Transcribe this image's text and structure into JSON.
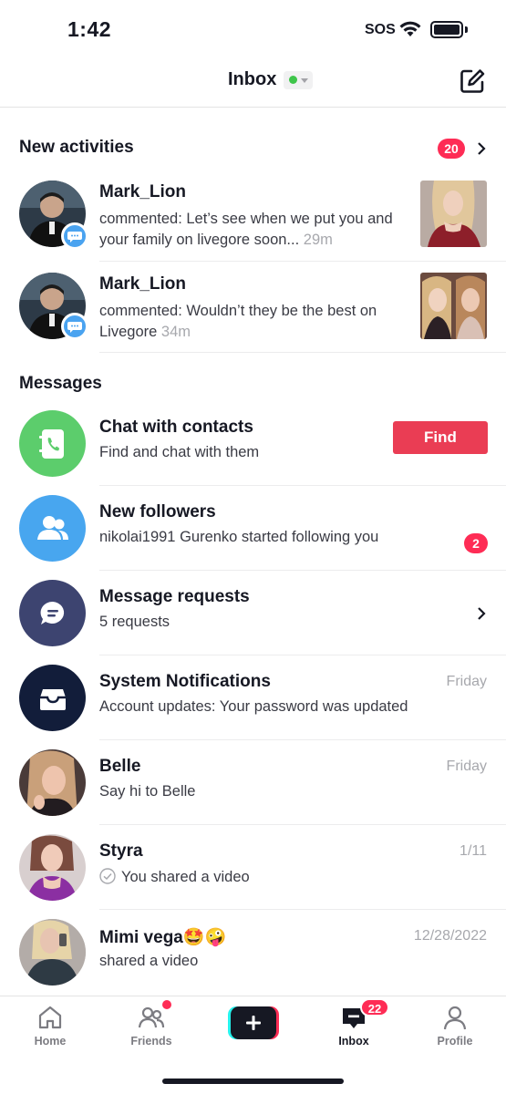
{
  "status_bar": {
    "time": "1:42",
    "sos": "SOS"
  },
  "header": {
    "title": "Inbox"
  },
  "activities": {
    "section_title": "New activities",
    "badge_count": "20",
    "items": [
      {
        "name": "Mark_Lion",
        "text": "commented: Let’s see when we put you and your family on livegore soon...",
        "time": "29m"
      },
      {
        "name": "Mark_Lion",
        "text": "commented: Wouldn’t they be the best on Livegore",
        "time": "34m"
      }
    ]
  },
  "messages": {
    "section_title": "Messages",
    "chat_contacts": {
      "title": "Chat with contacts",
      "subtitle": "Find and chat with them",
      "button": "Find"
    },
    "new_followers": {
      "title": "New followers",
      "subtitle": "nikolai1991 Gurenko started following you",
      "badge": "2"
    },
    "message_requests": {
      "title": "Message requests",
      "subtitle": "5 requests"
    },
    "system": {
      "title": "System Notifications",
      "subtitle": "Account updates: Your password was updated",
      "time": "Friday"
    },
    "belle": {
      "title": "Belle",
      "subtitle": "Say hi to Belle",
      "time": "Friday"
    },
    "styra": {
      "title": "Styra",
      "subtitle": "You shared a video",
      "time": "1/11"
    },
    "mimi": {
      "title": "Mimi vega",
      "emoji": "🤩🤪",
      "subtitle": "shared a video",
      "time": "12/28/2022"
    }
  },
  "nav": {
    "home": "Home",
    "friends": "Friends",
    "inbox": "Inbox",
    "inbox_badge": "22",
    "profile": "Profile"
  },
  "colors": {
    "accent": "#fe2c55",
    "find_button": "#ea3d54",
    "online": "#3ec54a"
  }
}
